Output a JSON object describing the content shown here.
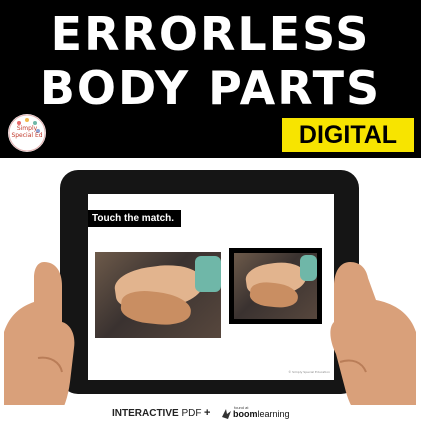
{
  "cover": {
    "title_line1": "ERRORLESS",
    "title_line2": "BODY PARTS",
    "badge": "DIGITAL",
    "logo_text": "Simply Special Ed",
    "colors": {
      "banner": "#000000",
      "badge": "#f7e400",
      "sleeve": "#6fb7a8"
    }
  },
  "tablet": {
    "prompt": "Touch the match.",
    "credit": "© Simply Special Education"
  },
  "footer": {
    "interactive": "INTERACTIVE",
    "pdf": "PDF",
    "plus": "+",
    "boom_small": "found at",
    "boom_bold": "boom",
    "boom_light": "learning"
  },
  "icons": {
    "logo": "logo-icon",
    "boom": "boom-bird-icon"
  }
}
